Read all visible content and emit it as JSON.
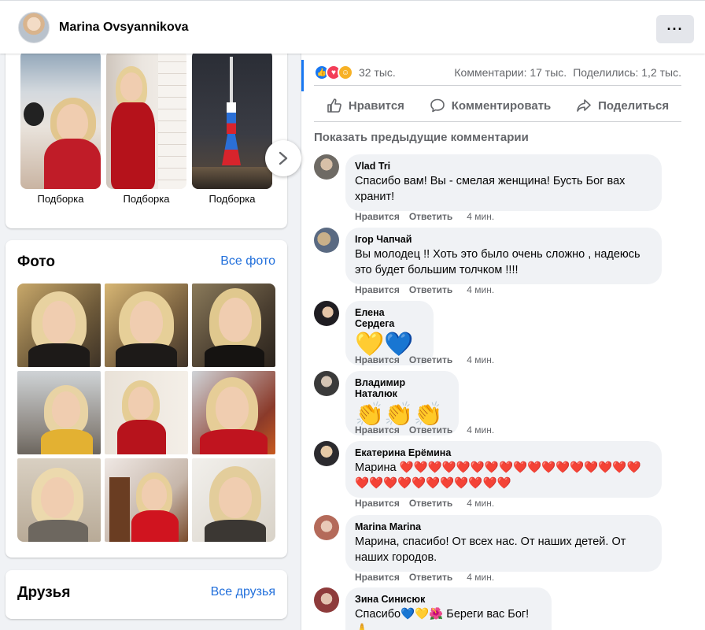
{
  "header": {
    "profile_name": "Marina Ovsyannikova",
    "more_label": "···"
  },
  "collections": {
    "items": [
      {
        "label": "Подборка"
      },
      {
        "label": "Подборка"
      },
      {
        "label": "Подборка"
      }
    ],
    "next_icon": "chevron-right-icon"
  },
  "photos": {
    "title": "Фото",
    "link": "Все фото"
  },
  "friends": {
    "title": "Друзья",
    "link": "Все друзья"
  },
  "post": {
    "reactions_count": "32 тыс.",
    "comments_count": "Комментарии: 17 тыс.",
    "shares_count": "Поделились: 1,2 тыс.",
    "actions": {
      "like": "Нравится",
      "comment": "Комментировать",
      "share": "Поделиться"
    },
    "show_previous": "Показать предыдущие комментарии"
  },
  "comments": [
    {
      "author": "Vlad Tri",
      "text": "Спасибо вам! Вы - смелая женщина! Бусть Бог вах хранит!",
      "like": "Нравится",
      "reply": "Ответить",
      "time": "4 мин."
    },
    {
      "author": "Ігор Чапчай",
      "text": "Вы молодец !! Хоть это было очень сложно , надеюсь это будет большим толчком !!!!",
      "like": "Нравится",
      "reply": "Ответить",
      "time": "4 мин."
    },
    {
      "author": "Елена Сердега",
      "text": "💛💙",
      "like": "Нравится",
      "reply": "Ответить",
      "time": "4 мин."
    },
    {
      "author": "Владимир Наталюк",
      "text": "👏👏👏",
      "like": "Нравится",
      "reply": "Ответить",
      "time": "4 мин."
    },
    {
      "author": "Екатерина Ерёмина",
      "text_prefix": "Марина ",
      "text": "❤️❤️❤️❤️❤️❤️❤️❤️❤️❤️❤️❤️❤️❤️❤️❤️❤️❤️❤️❤️❤️❤️❤️❤️❤️❤️❤️❤️",
      "like": "Нравится",
      "reply": "Ответить",
      "time": "4 мин."
    },
    {
      "author": "Marina Marina",
      "text": "Марина, спасибо! От всех нас. От наших детей. От наших городов.",
      "like": "Нравится",
      "reply": "Ответить",
      "time": "4 мин."
    },
    {
      "author": "Зина Синисюк",
      "text": "Спасибо💙💛🌺 Береги вас Бог!🙏"
    }
  ],
  "colors": {
    "link": "#216fdb",
    "like_blue": "#1877f2",
    "love_red": "#f33e58",
    "care_yellow": "#f7b125",
    "bubble_bg": "#f0f2f5"
  }
}
